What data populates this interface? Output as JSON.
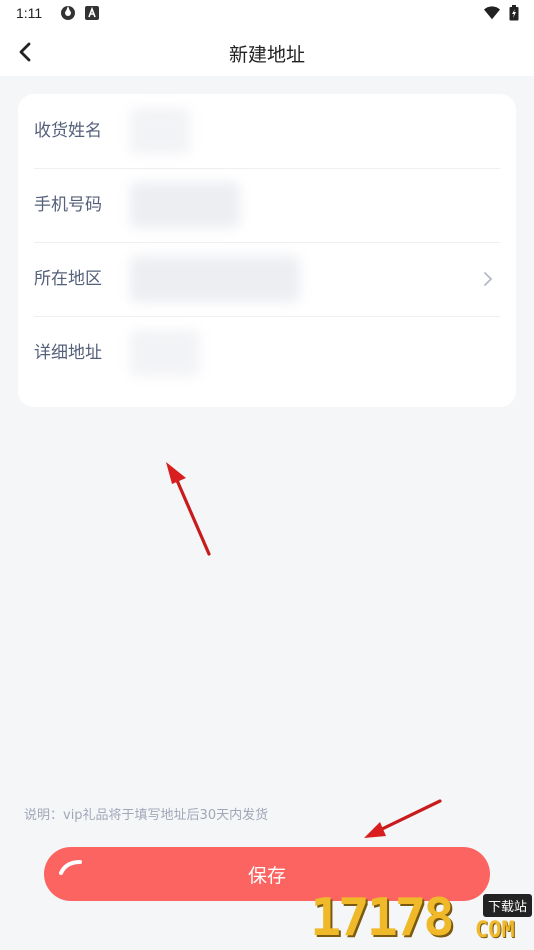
{
  "status_bar": {
    "time": "1:11",
    "icons": [
      "sync-icon",
      "a-badge-icon",
      "wifi-icon",
      "battery-icon"
    ]
  },
  "nav": {
    "title": "新建地址",
    "back_icon": "chevron-left-icon"
  },
  "form": {
    "fields": [
      {
        "label": "收货姓名",
        "value": "",
        "blurred": true
      },
      {
        "label": "手机号码",
        "value": "",
        "blurred": true
      },
      {
        "label": "所在地区",
        "value": "",
        "blurred": true,
        "has_chevron": true
      },
      {
        "label": "详细地址",
        "value": "",
        "blurred": true
      }
    ]
  },
  "note": "说明：vip礼品将于填写地址后30天内发货",
  "save_button": {
    "label": "保存"
  },
  "watermark": {
    "brand": "17178",
    "domain": "COM",
    "tag": "下载站"
  },
  "colors": {
    "accent": "#fb6461",
    "annotation_arrow": "#d81e1e",
    "label": "#55607a",
    "background": "#f5f6f8"
  }
}
